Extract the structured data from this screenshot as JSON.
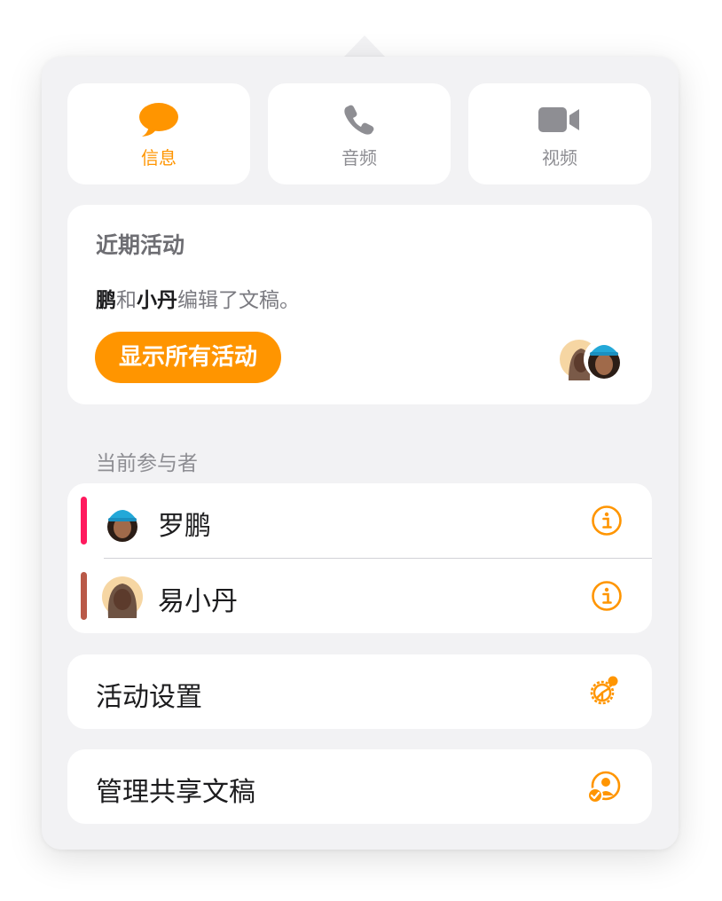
{
  "comm_buttons": [
    {
      "label": "信息",
      "icon": "message-bubble-icon",
      "active": true
    },
    {
      "label": "音频",
      "icon": "phone-icon",
      "active": false
    },
    {
      "label": "视频",
      "icon": "video-camera-icon",
      "active": false
    }
  ],
  "recent_activity": {
    "title": "近期活动",
    "summary": {
      "name1": "鹏",
      "conj": "和",
      "name2": "小丹",
      "rest": "编辑了文稿。"
    },
    "show_all_label": "显示所有活动"
  },
  "participants_header": "当前参与者",
  "participants": [
    {
      "name": "罗鹏",
      "color": "#ff1a5e",
      "avatar": "memoji-avatar"
    },
    {
      "name": "易小丹",
      "color": "#b95948",
      "avatar": "memoji-avatar"
    }
  ],
  "activity_settings_label": "活动设置",
  "manage_shared_label": "管理共享文稿",
  "colors": {
    "accent": "#ff9500",
    "secondary_text": "#8e8e93",
    "panel_bg": "#f2f2f4"
  }
}
